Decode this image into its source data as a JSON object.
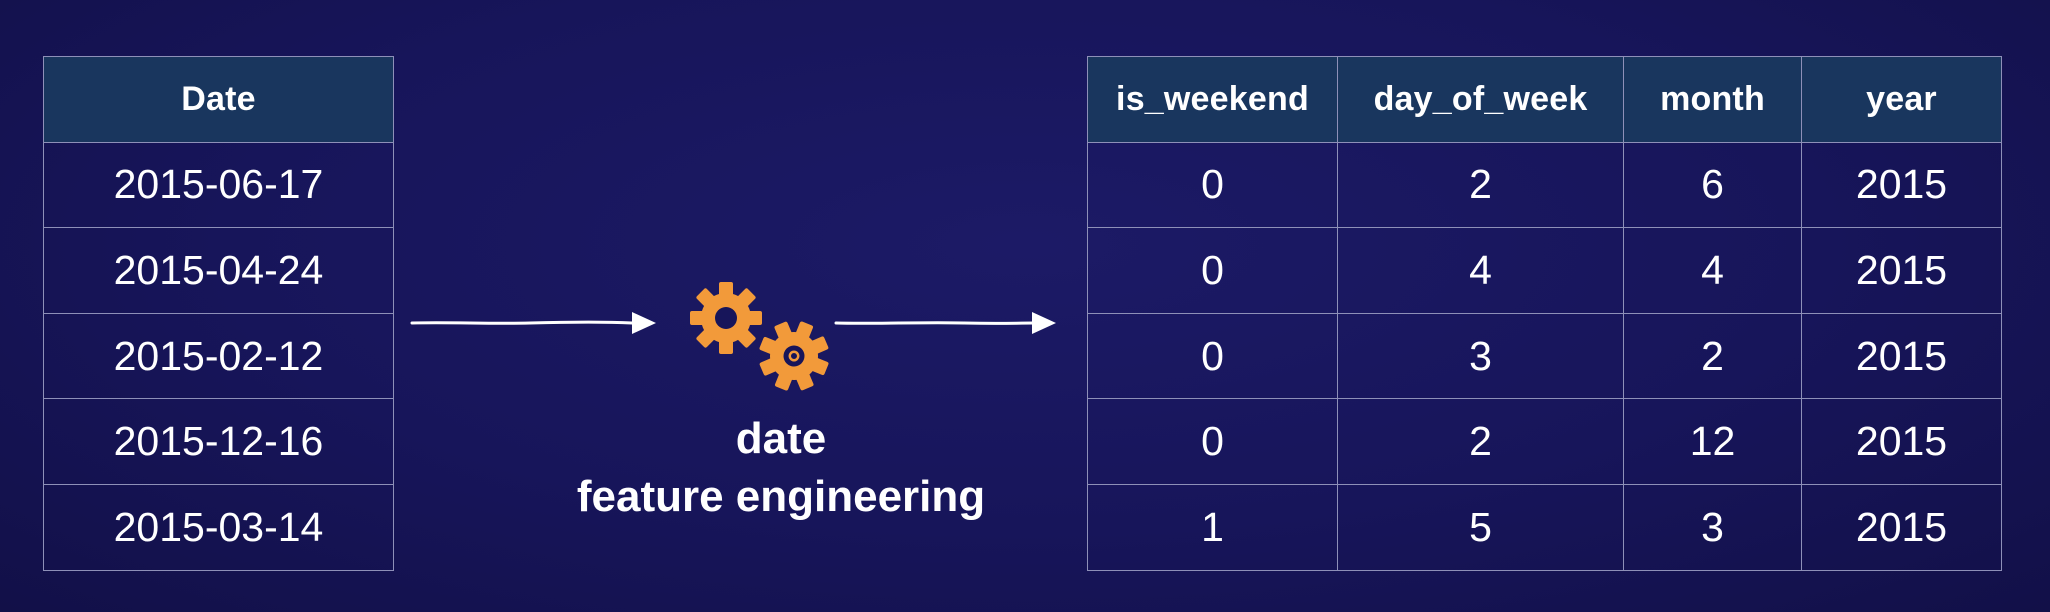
{
  "input_table": {
    "header": "Date",
    "rows": [
      "2015-06-17",
      "2015-04-24",
      "2015-02-12",
      "2015-12-16",
      "2015-03-14"
    ]
  },
  "output_table": {
    "headers": [
      "is_weekend",
      "day_of_week",
      "month",
      "year"
    ],
    "rows": [
      [
        "0",
        "2",
        "6",
        "2015"
      ],
      [
        "0",
        "4",
        "4",
        "2015"
      ],
      [
        "0",
        "3",
        "2",
        "2015"
      ],
      [
        "0",
        "2",
        "12",
        "2015"
      ],
      [
        "1",
        "5",
        "3",
        "2015"
      ]
    ]
  },
  "process": {
    "line1": "date",
    "line2": "feature engineering",
    "icon": "gears-icon",
    "icon_color": "#f29a3a"
  },
  "colors": {
    "background": "#17155a",
    "header_fill": "#19365e",
    "grid": "#8e90b8",
    "arrow": "#ffffff"
  }
}
